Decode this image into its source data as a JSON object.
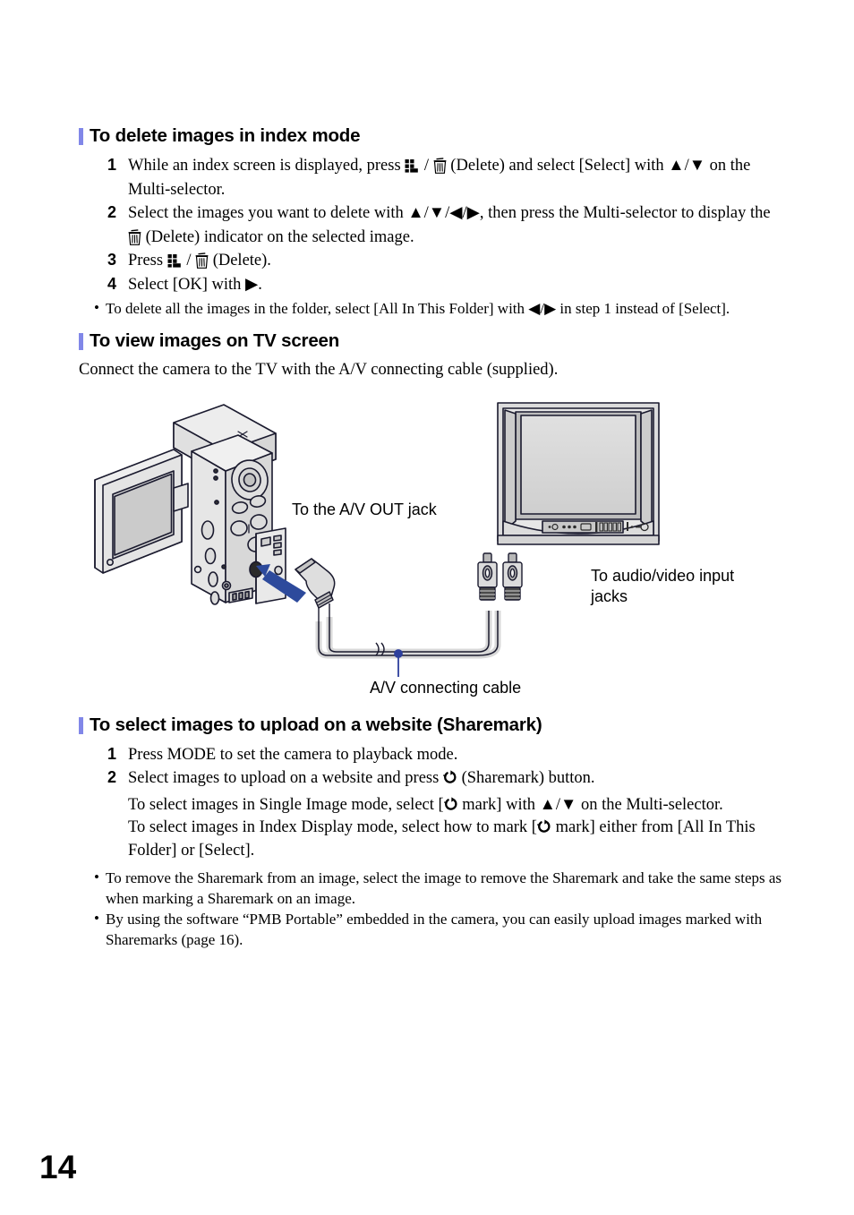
{
  "page": {
    "number": "14"
  },
  "sections": {
    "delete_index": {
      "heading": "To delete images in index mode",
      "steps": [
        {
          "num": "1",
          "text_before_icons": "While an index screen is displayed, press ",
          "icon1": "index-icon",
          "sep": " / ",
          "icon2": "delete-trash-icon",
          "text_after_icons": " (Delete) and select [Select] with ▲/▼ on the Multi-selector."
        },
        {
          "num": "2",
          "text_before_icons": "Select the images you want to delete with ▲/▼/◀/▶, then press the Multi-selector to display the ",
          "icon1": "delete-trash-icon",
          "text_after_icons": " (Delete) indicator on the selected image."
        },
        {
          "num": "3",
          "text_before_icons": "Press ",
          "icon1": "index-icon",
          "sep": " / ",
          "icon2": "delete-trash-icon",
          "text_after_icons": " (Delete)."
        },
        {
          "num": "4",
          "text_before_icons": "Select [OK] with ▶."
        }
      ],
      "bullets": [
        {
          "dot": "•",
          "text": "To delete all the images in the folder, select [All In This Folder] with ◀/▶ in step 1 instead of [Select]."
        }
      ]
    },
    "view_tv": {
      "heading": "To view images on TV screen",
      "intro": "Connect the camera to the TV with the A/V connecting cable (supplied).",
      "figure": {
        "label_av_out": "To the A/V OUT jack",
        "label_audio_video_in": "To audio/video input\njacks",
        "label_cable": "A/V connecting cable"
      }
    },
    "sharemark": {
      "heading": "To select images to upload on a website (Sharemark)",
      "steps": [
        {
          "num": "1",
          "text_before_icons": "Press MODE to set the camera to playback mode."
        },
        {
          "num": "2",
          "text_before_icons": "Select images to upload on a website and press ",
          "icon1": "sharemark-icon",
          "text_after_icons": " (Sharemark) button."
        }
      ],
      "notes": [
        {
          "before": "To select images in Single Image mode, select [",
          "icon": "sharemark-icon",
          "after": " mark] with ▲/▼ on the Multi-selector."
        },
        {
          "before": "To select images in Index Display mode, select how to mark [",
          "icon": "sharemark-icon",
          "after": " mark] either from [All In This Folder] or [Select]."
        }
      ],
      "bullets": [
        {
          "dot": "•",
          "text": "To remove the Sharemark from an image, select the image to remove the Sharemark and take the same steps as when marking a Sharemark on an image."
        },
        {
          "dot": "•",
          "text": "By using the software “PMB Portable” embedded in the camera, you can easily upload images marked with Sharemarks (page 16)."
        }
      ]
    }
  },
  "colors": {
    "accent_bar": "#8187e8",
    "arrow_callout": "#2d4a9c",
    "cable_dot": "#2d3f9c",
    "line": "#1a1a2e",
    "fill_light": "#e9e9e9",
    "fill_mid": "#d2d2d2",
    "fill_dark": "#a8a8a8"
  }
}
